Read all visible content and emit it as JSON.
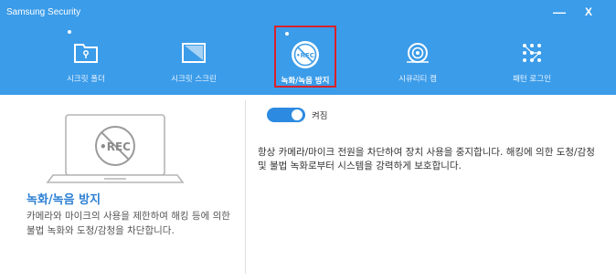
{
  "window": {
    "title": "Samsung Security",
    "minimize_glyph": "—",
    "close_glyph": "X"
  },
  "colors": {
    "header_bg": "#3b9ce9",
    "accent": "#2c8ae0",
    "active_border": "#d9222a",
    "feature_title": "#2c7fd4"
  },
  "nav": {
    "items": [
      {
        "label": "시크릿 폴더",
        "icon": "secret-folder-icon",
        "active": false,
        "dot": true
      },
      {
        "label": "시크릿 스크린",
        "icon": "secret-screen-icon",
        "active": false,
        "dot": false
      },
      {
        "label": "녹화/녹음 방지",
        "icon": "no-rec-icon",
        "active": true,
        "dot": true
      },
      {
        "label": "시큐리티 캠",
        "icon": "security-cam-icon",
        "active": false,
        "dot": false
      },
      {
        "label": "패턴 로그인",
        "icon": "pattern-login-icon",
        "active": false,
        "dot": false
      }
    ]
  },
  "left": {
    "illustration_icon": "laptop-rec-blocked-icon",
    "rec_text": "•REC",
    "title": "녹화/녹음 방지",
    "description": "카메라와 마이크의 사용을 제한하여 해킹 등에 의한 불법 녹화와 도청/감청을 차단합니다."
  },
  "main": {
    "toggle_on": true,
    "toggle_label": "켜짐",
    "description": "항상 카메라/마이크 전원을 차단하여 장치 사용을 중지합니다. 해킹에 의한 도청/감청 및 불법 녹화로부터 시스템을 강력하게 보호합니다."
  }
}
